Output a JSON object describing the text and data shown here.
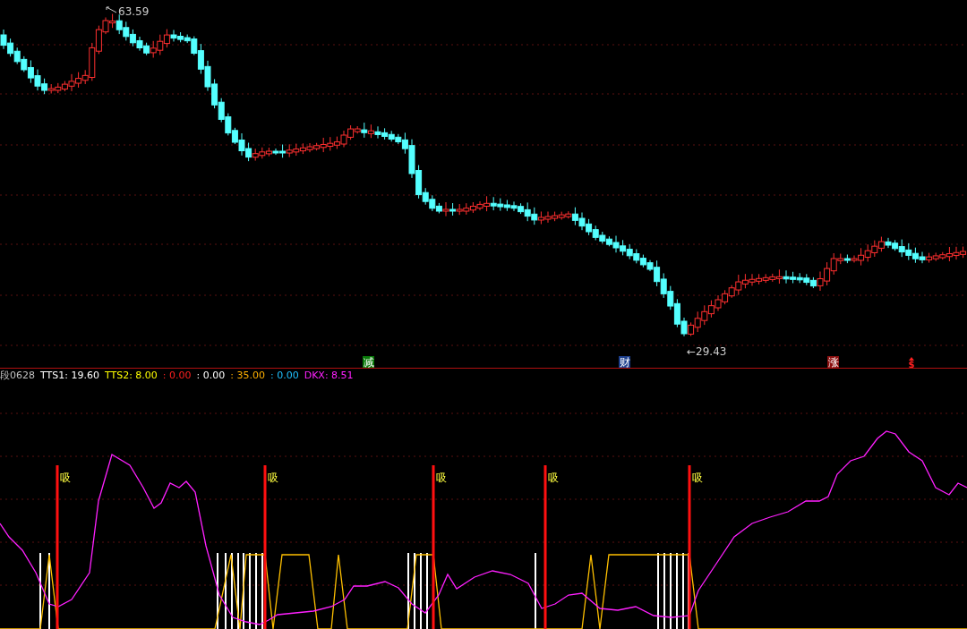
{
  "price_chart": {
    "high_label": "63.59",
    "low_label": "←29.43",
    "markers": [
      {
        "kind": "badge",
        "label": "减",
        "color": "#0a7a0a"
      },
      {
        "kind": "badge",
        "label": "财",
        "color": "#1d3f8c"
      },
      {
        "kind": "badge",
        "label": "涨",
        "color": "#8b1010"
      },
      {
        "kind": "arrow",
        "label": "$",
        "color": "#ff2020"
      }
    ]
  },
  "indicator": {
    "legend": [
      {
        "label": "段0628",
        "color": "#c0c0c0"
      },
      {
        "label": "TTS1: 19.60",
        "color": "#ffffff"
      },
      {
        "label": "TTS2: 8.00",
        "color": "#ffff00"
      },
      {
        "label": ": 0.00",
        "color": "#ff2020"
      },
      {
        "label": ": 0.00",
        "color": "#ffffff"
      },
      {
        "label": ": 35.00",
        "color": "#ffb000"
      },
      {
        "label": ": 0.00",
        "color": "#20c0ff"
      },
      {
        "label": "DKX: 8.51",
        "color": "#ff20ff"
      }
    ],
    "signals": [
      {
        "label": "吸"
      },
      {
        "label": "吸"
      },
      {
        "label": "吸"
      },
      {
        "label": "吸"
      },
      {
        "label": "吸"
      }
    ]
  }
}
